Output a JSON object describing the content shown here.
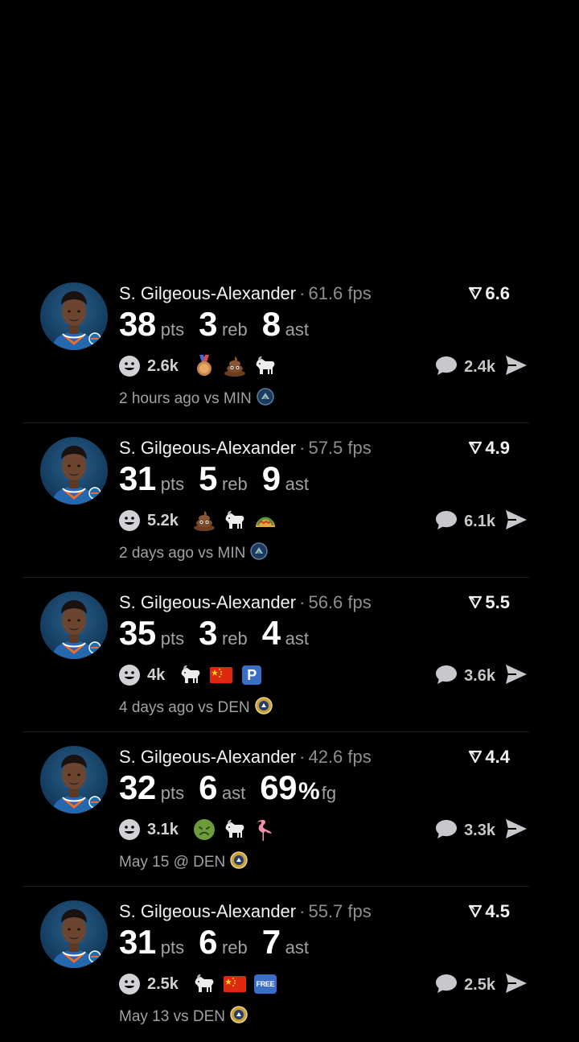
{
  "feed": [
    {
      "player": "S. Gilgeous-Alexander",
      "fps": "61.6 fps",
      "rating": "6.6",
      "stats": [
        {
          "num": "38",
          "unit": "pts"
        },
        {
          "num": "3",
          "unit": "reb"
        },
        {
          "num": "8",
          "unit": "ast"
        }
      ],
      "reaction_count": "2.6k",
      "emojis": [
        "medal-icon",
        "poop-icon",
        "goat-icon"
      ],
      "comments": "2.4k",
      "time": "2 hours ago vs MIN",
      "team": "min"
    },
    {
      "player": "S. Gilgeous-Alexander",
      "fps": "57.5 fps",
      "rating": "4.9",
      "stats": [
        {
          "num": "31",
          "unit": "pts"
        },
        {
          "num": "5",
          "unit": "reb"
        },
        {
          "num": "9",
          "unit": "ast"
        }
      ],
      "reaction_count": "5.2k",
      "emojis": [
        "poop-icon",
        "goat-icon",
        "taco-icon"
      ],
      "comments": "6.1k",
      "time": "2 days ago vs MIN",
      "team": "min"
    },
    {
      "player": "S. Gilgeous-Alexander",
      "fps": "56.6 fps",
      "rating": "5.5",
      "stats": [
        {
          "num": "35",
          "unit": "pts"
        },
        {
          "num": "3",
          "unit": "reb"
        },
        {
          "num": "4",
          "unit": "ast"
        }
      ],
      "reaction_count": "4k",
      "emojis": [
        "goat-icon",
        "china-flag-icon",
        "parking-icon"
      ],
      "comments": "3.6k",
      "time": "4 days ago vs DEN",
      "team": "den"
    },
    {
      "player": "S. Gilgeous-Alexander",
      "fps": "42.6 fps",
      "rating": "4.4",
      "stats": [
        {
          "num": "32",
          "unit": "pts"
        },
        {
          "num": "6",
          "unit": "ast"
        },
        {
          "num": "69",
          "pct": "%",
          "unit": "fg"
        }
      ],
      "reaction_count": "3.1k",
      "emojis": [
        "nauseated-face-icon",
        "goat-icon",
        "flamingo-icon"
      ],
      "comments": "3.3k",
      "time": "May 15 @ DEN",
      "team": "den"
    },
    {
      "player": "S. Gilgeous-Alexander",
      "fps": "55.7 fps",
      "rating": "4.5",
      "stats": [
        {
          "num": "31",
          "unit": "pts"
        },
        {
          "num": "6",
          "unit": "reb"
        },
        {
          "num": "7",
          "unit": "ast"
        }
      ],
      "reaction_count": "2.5k",
      "emojis": [
        "goat-icon",
        "china-flag-icon",
        "free-button-icon"
      ],
      "comments": "2.5k",
      "time": "May 13 vs DEN",
      "team": "den"
    }
  ],
  "free_label": "FREE",
  "parking_label": "P",
  "colors": {
    "background": "#000000",
    "muted": "#8e8e93",
    "text": "#f2f2f2",
    "thunder_blue": "#1e6fb8",
    "min_navy": "#1b3a5c",
    "den_gold": "#c9a13a"
  }
}
